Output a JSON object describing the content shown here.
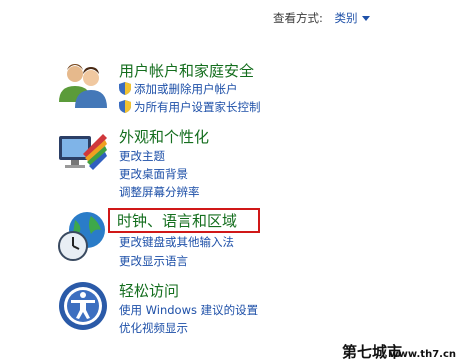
{
  "view_by": {
    "label": "查看方式:",
    "value": "类别"
  },
  "categories": [
    {
      "title": "用户帐户和家庭安全",
      "links": [
        "添加或删除用户帐户",
        "为所有用户设置家长控制"
      ]
    },
    {
      "title": "外观和个性化",
      "links": [
        "更改主题",
        "更改桌面背景",
        "调整屏幕分辨率"
      ]
    },
    {
      "title": "时钟、语言和区域",
      "links": [
        "更改键盘或其他输入法",
        "更改显示语言"
      ]
    },
    {
      "title": "轻松访问",
      "links": [
        "使用 Windows 建议的设置",
        "优化视频显示"
      ]
    }
  ],
  "watermark": {
    "logo_text": "第七城市",
    "url": "www.th7.cn"
  },
  "colors": {
    "category_title": "#146e1e",
    "link": "#1e50a8",
    "highlight": "#d01818"
  }
}
